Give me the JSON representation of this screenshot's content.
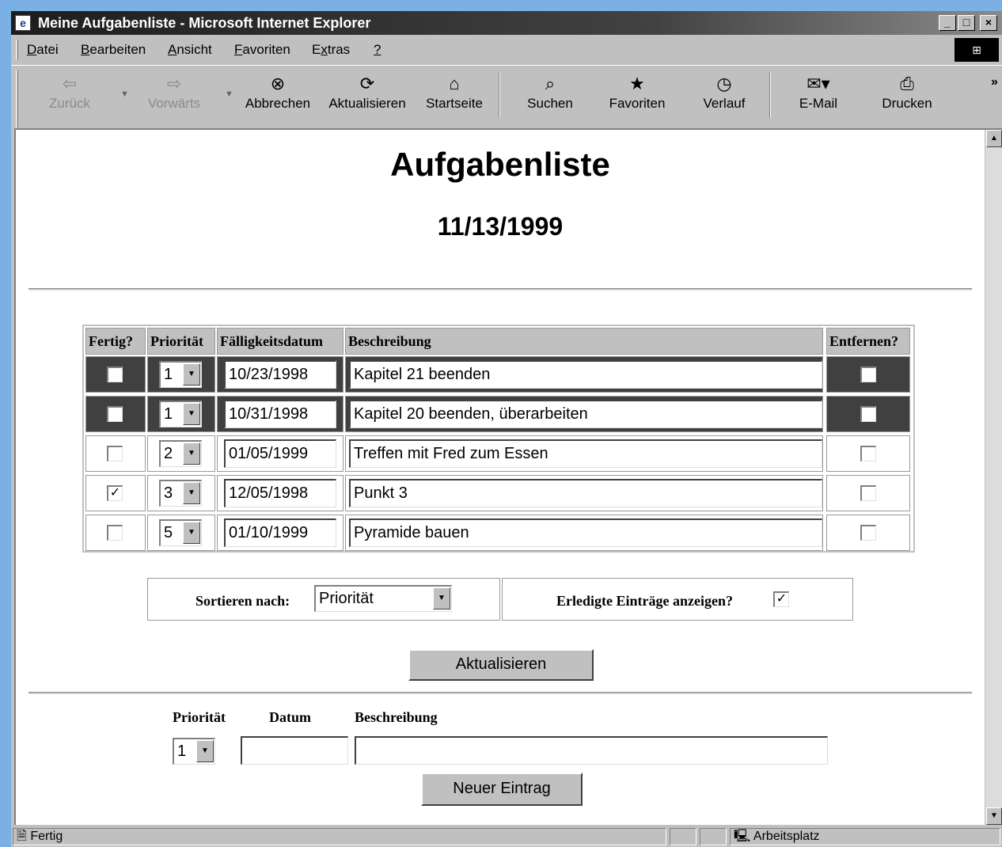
{
  "window": {
    "title": "Meine Aufgabenliste - Microsoft Internet Explorer",
    "min": "_",
    "max": "□",
    "close": "×"
  },
  "menu": [
    {
      "u": "D",
      "rest": "atei"
    },
    {
      "u": "B",
      "rest": "earbeiten"
    },
    {
      "u": "A",
      "rest": "nsicht"
    },
    {
      "u": "F",
      "rest": "avoriten"
    },
    {
      "pre": "E",
      "u": "x",
      "rest": "tras"
    },
    {
      "u": "?",
      "rest": ""
    }
  ],
  "toolbar": {
    "back": "Zurück",
    "forward": "Vorwärts",
    "stop": "Abbrechen",
    "refresh": "Aktualisieren",
    "home": "Startseite",
    "search": "Suchen",
    "favorites": "Favoriten",
    "history": "Verlauf",
    "mail": "E-Mail",
    "print": "Drucken"
  },
  "page": {
    "title": "Aufgabenliste",
    "date": "11/13/1999"
  },
  "table": {
    "headers": [
      "Fertig?",
      "Priorität",
      "Fälligkeitsdatum",
      "Beschreibung",
      "Entfernen?"
    ],
    "rows": [
      {
        "done": false,
        "priority": "1",
        "date": "10/23/1998",
        "desc": "Kapitel 21 beenden",
        "remove": false,
        "overdue": true
      },
      {
        "done": false,
        "priority": "1",
        "date": "10/31/1998",
        "desc": "Kapitel 20 beenden, überarbeiten",
        "remove": false,
        "overdue": true
      },
      {
        "done": false,
        "priority": "2",
        "date": "01/05/1999",
        "desc": "Treffen mit Fred zum Essen",
        "remove": false,
        "overdue": false
      },
      {
        "done": true,
        "priority": "3",
        "date": "12/05/1998",
        "desc": "Punkt 3",
        "remove": false,
        "overdue": false
      },
      {
        "done": false,
        "priority": "5",
        "date": "01/10/1999",
        "desc": "Pyramide bauen",
        "remove": false,
        "overdue": false
      }
    ]
  },
  "options": {
    "sort_label": "Sortieren nach:",
    "sort_value": "Priorität",
    "show_done_label": "Erledigte Einträge anzeigen?",
    "show_done": true
  },
  "update_button": "Aktualisieren",
  "new_entry": {
    "priority_label": "Priorität",
    "date_label": "Datum",
    "desc_label": "Beschreibung",
    "priority_value": "1",
    "date_value": "",
    "desc_value": "",
    "button": "Neuer Eintrag"
  },
  "status": {
    "text": "Fertig",
    "zone": "Arbeitsplatz"
  }
}
